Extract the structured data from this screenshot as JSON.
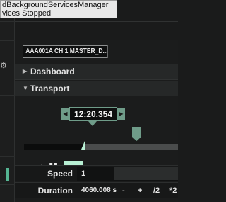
{
  "tooltip": {
    "line1": "dBackgroundServicesManager",
    "line2": "vices Stopped"
  },
  "left_column": {
    "icon": "gear-icon"
  },
  "clip": {
    "name": "AAA001A CH 1 MASTER_D..."
  },
  "sections": {
    "dashboard": {
      "label": "Dashboard",
      "icon": "triangle-right-icon"
    },
    "transport": {
      "label": "Transport",
      "icon": "triangle-down-icon"
    }
  },
  "transport": {
    "timecode": "12:20.354",
    "step_back_icon": "chevron-left-icon",
    "step_forward_icon": "chevron-right-icon",
    "rewind_icon": "triangle-left-icon",
    "pause_icon": "pause-icon",
    "play_icon": "play-icon",
    "playhead_fraction": 0.39
  },
  "properties": {
    "speed": {
      "label": "Speed",
      "value": "1"
    },
    "duration": {
      "label": "Duration",
      "value": "4060.008 s",
      "buttons": [
        "-",
        "+",
        "/2",
        "*2"
      ]
    }
  },
  "colors": {
    "accent": "#b8f0d4",
    "accent_dark": "#6f9c89",
    "panel_bg": "#1b1c1c",
    "header_bg": "#262828"
  }
}
